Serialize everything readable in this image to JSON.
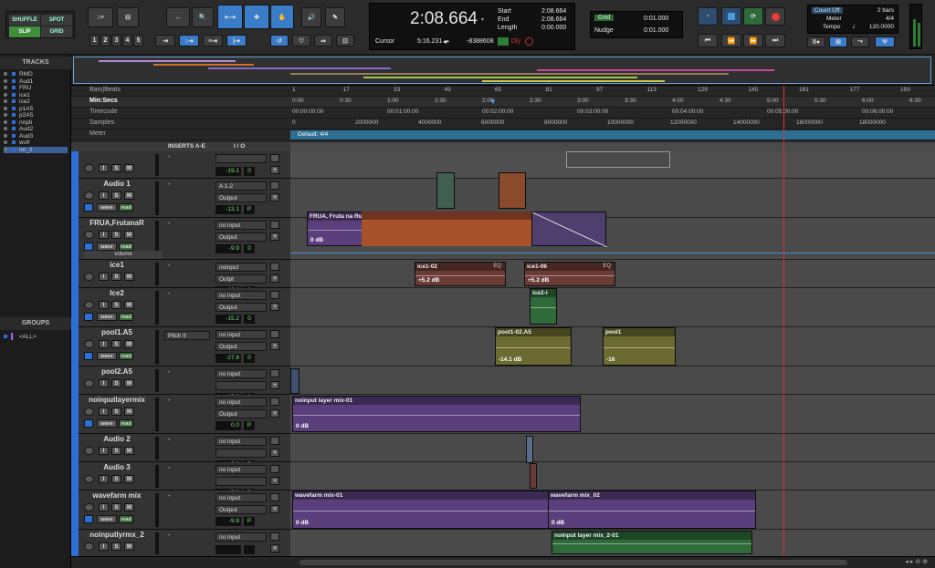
{
  "modes": {
    "shuffle": "SHUFFLE",
    "spot": "SPOT",
    "slip": "SLIP",
    "grid": "GRID"
  },
  "zoom_presets": [
    "1",
    "2",
    "3",
    "4",
    "5"
  ],
  "counter": {
    "main": "2:08.664",
    "cursor_label": "Cursor",
    "cursor_value": "5:16.231",
    "sample_offset": "-8388608",
    "dly_label": "Dly",
    "start_label": "Start",
    "end_label": "End",
    "length_label": "Length",
    "start": "2:08.664",
    "end": "2:08.664",
    "length": "0:00.000"
  },
  "grid": {
    "label": "Grid",
    "value": "0:01.000",
    "nudge_label": "Nudge",
    "nudge_value": "0:01.000"
  },
  "countoff": {
    "label": "Count Off",
    "bars": "2 bars",
    "meter_label": "Meter",
    "meter": "4/4",
    "tempo_label": "Tempo",
    "tempo": "120.0000"
  },
  "tracks_panel": {
    "title": "TRACKS",
    "items": [
      "RMD",
      "Aud1",
      "FRU",
      "ice1",
      "ice2",
      "p1A5",
      "p2A5",
      "nnpti",
      "Aud2",
      "Aud3",
      "wvfr",
      "nn_2"
    ]
  },
  "groups_panel": {
    "title": "GROUPS",
    "all": "<ALL>"
  },
  "rulers": {
    "bars_label": "Bars|Beats",
    "min_label": "Min:Secs",
    "tc_label": "Timecode",
    "samples_label": "Samples",
    "meter_label": "Meter",
    "meter_default": "Default: 4/4",
    "bars": [
      "1",
      "17",
      "33",
      "49",
      "65",
      "81",
      "97",
      "113",
      "129",
      "145",
      "161",
      "177",
      "193"
    ],
    "mins": [
      "0:00",
      "0:30",
      "1:00",
      "1:30",
      "2:00",
      "2:30",
      "3:00",
      "3:30",
      "4:00",
      "4:30",
      "5:00",
      "5:30",
      "6:00",
      "6:30"
    ],
    "tc": [
      "00:00:00:00",
      "00:01:00:00",
      "00:02:00:00",
      "00:03:00:00",
      "00:04:00:00",
      "00:05:00:00",
      "00:06:00:00"
    ],
    "samples": [
      "0",
      "2000000",
      "4000000",
      "6000000",
      "8000000",
      "10000000",
      "12000000",
      "14000000",
      "16000000",
      "18000000"
    ]
  },
  "header_cols": {
    "inserts": "INSERTS A-E",
    "io": "I / O"
  },
  "tracks": [
    {
      "name": "",
      "vol": "-19.1",
      "pan": "0",
      "in": "",
      "out": ""
    },
    {
      "name": "Audio 1",
      "vol": "-13.1",
      "pan": "P",
      "in": "A 1-2",
      "out": "Output"
    },
    {
      "name": "FRUA,FrutanaR",
      "vol": "-9.9",
      "pan": "0",
      "in": "no input",
      "out": "Output",
      "automation": "volume"
    },
    {
      "name": "ice1",
      "vol": "-10.6",
      "pan": "0",
      "in": "noinput",
      "out": "Outpt"
    },
    {
      "name": "Ice2",
      "vol": "-15.2",
      "pan": "0",
      "in": "no input",
      "out": "Output"
    },
    {
      "name": "pool1.A5",
      "vol": "-27.8",
      "pan": "0",
      "in": "no input",
      "out": "Output",
      "insert": "Pitch II"
    },
    {
      "name": "pool2.A5",
      "vol": "-15.2",
      "pan": "0",
      "in": "no input",
      "out": ""
    },
    {
      "name": "noinputlayermix",
      "vol": "0.0",
      "pan": "P",
      "in": "no input",
      "out": "Output"
    },
    {
      "name": "Audio 2",
      "vol": "-5.3",
      "pan": "P",
      "in": "no input",
      "out": ""
    },
    {
      "name": "Audio 3",
      "vol": "-7.3",
      "pan": "P",
      "in": "no input",
      "out": ""
    },
    {
      "name": "wavefarm mix",
      "vol": "-9.9",
      "pan": "P",
      "in": "no input",
      "out": "Output"
    },
    {
      "name": "noinputlyrmx_2",
      "vol": "",
      "pan": "",
      "in": "no input",
      "out": "Output"
    }
  ],
  "clips": [
    {
      "name": "FRUA, Fruta na Rua-04",
      "gain": "0 dB"
    },
    {
      "name": "ice1-02",
      "gain": "+5.2 dB",
      "tag": "EQ"
    },
    {
      "name": "ice1-06",
      "gain": "+5.2 dB",
      "tag": "EQ"
    },
    {
      "name": "ice2-i",
      "gain": ""
    },
    {
      "name": "pool1-02.A5",
      "gain": "-14.1 dB"
    },
    {
      "name": "pool1",
      "gain": "-16"
    },
    {
      "name": "noinput layer mix-01",
      "gain": "0 dB"
    },
    {
      "name": "wavefarm mix-01",
      "gain": "0 dB"
    },
    {
      "name": "wavefarm mix_02",
      "gain": "0 dB"
    },
    {
      "name": "noinput layer mix_2-01",
      "gain": ""
    }
  ],
  "buttons": {
    "wave": "wave",
    "read": "read",
    "wrp": "wrp",
    "i": "I",
    "s": "S",
    "m": "M"
  },
  "colors": {
    "accent": "#2d6fd6",
    "counter": "#4fda5b",
    "purple": "#5a3f7c",
    "orange": "#b35c2b",
    "green": "#2f6a3a",
    "olive": "#6b6a30",
    "red_clip": "#6a3a35"
  }
}
